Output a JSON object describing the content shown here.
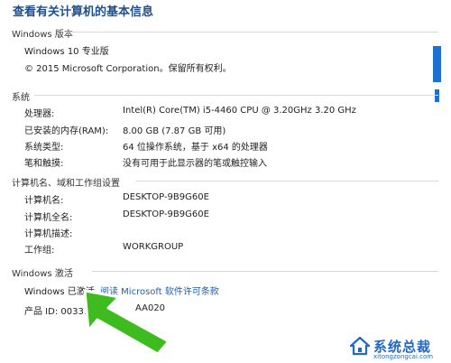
{
  "page": {
    "title": "查看有关计算机的基本信息"
  },
  "windows_edition": {
    "heading": "Windows 版本",
    "name": "Windows 10 专业版",
    "copyright": "© 2015 Microsoft Corporation。保留所有权利。"
  },
  "system": {
    "heading": "系统",
    "rows": [
      {
        "label": "处理器:",
        "value": "Intel(R) Core(TM) i5-4460  CPU @ 3.20GHz   3.20 GHz"
      },
      {
        "label": "已安装的内存(RAM):",
        "value": "8.00 GB (7.87 GB 可用)"
      },
      {
        "label": "系统类型:",
        "value": "64 位操作系统，基于 x64 的处理器"
      },
      {
        "label": "笔和触摸:",
        "value": "没有可用于此显示器的笔或触控输入"
      }
    ]
  },
  "computer": {
    "heading": "计算机名、域和工作组设置",
    "rows": [
      {
        "label": "计算机名:",
        "value": "DESKTOP-9B9G60E"
      },
      {
        "label": "计算机全名:",
        "value": "DESKTOP-9B9G60E"
      },
      {
        "label": "计算机描述:",
        "value": ""
      },
      {
        "label": "工作组:",
        "value": "WORKGROUP"
      }
    ]
  },
  "activation": {
    "heading": "Windows 激活",
    "status": "Windows 已激活",
    "license_link": "阅读 Microsoft 软件许可条款",
    "product_id_label": "产品 ID: 00331-10",
    "product_id_tail": "AA020"
  },
  "watermark": {
    "text": "系统总裁",
    "sub": "xitongzongcai.com"
  },
  "colors": {
    "accent": "#1d6fd6",
    "title": "#1f4e8c",
    "arrow": "#3dbb1f"
  }
}
